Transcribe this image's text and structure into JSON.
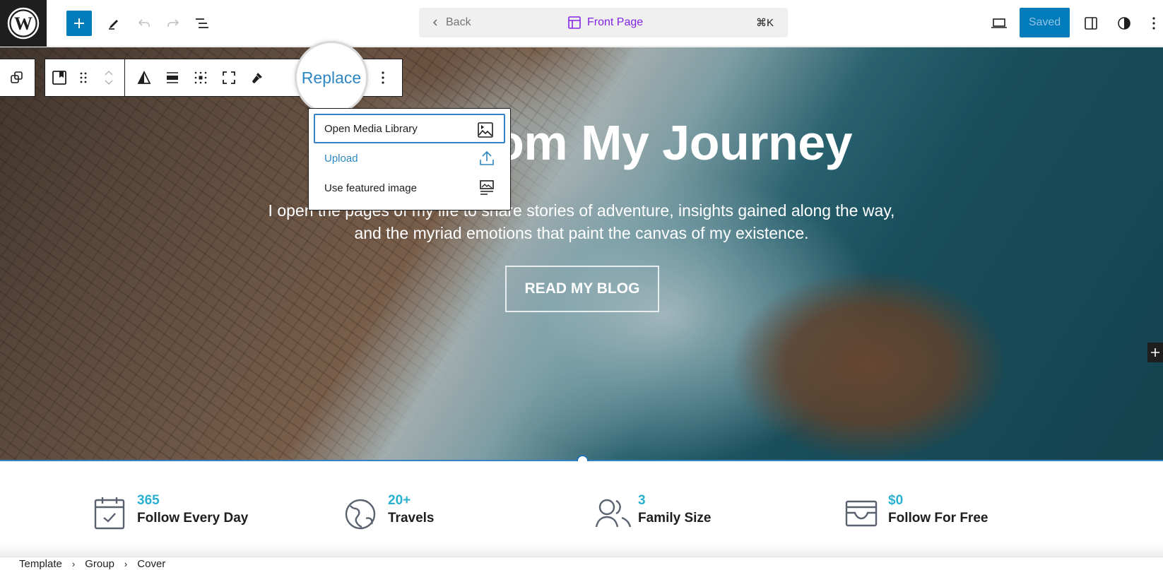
{
  "header": {
    "logo": "wordpress-logo",
    "inserter_icon": "plus-icon",
    "tools_icon": "pencil-icon",
    "undo_icon": "undo-icon",
    "redo_icon": "redo-icon",
    "document_overview_icon": "list-view-icon",
    "command_bar": {
      "back_label": "Back",
      "document_title": "Front Page",
      "shortcut": "⌘K"
    },
    "preview_icon": "desktop-icon",
    "save_label": "Saved",
    "settings_icon": "sidebar-toggle-icon",
    "styles_icon": "contrast-icon",
    "options_icon": "more-vertical-icon"
  },
  "block_toolbar": {
    "items": [
      "select-parent",
      "cover-block",
      "drag-handle",
      "move-up",
      "move-down",
      "duotone",
      "align",
      "content-position",
      "full-height",
      "overlay-color"
    ],
    "replace_label": "Replace",
    "more_icon": "more-vertical-icon"
  },
  "replace_menu": {
    "items": [
      {
        "label": "Open Media Library",
        "icon": "media-icon",
        "focused": true
      },
      {
        "label": "Upload",
        "icon": "upload-icon",
        "accent": "#2e87c2"
      },
      {
        "label": "Use featured image",
        "icon": "featured-image-icon"
      }
    ]
  },
  "cover": {
    "heading": "Tales From My Journey",
    "text": "I open the pages of my life to share stories of adventure, insights gained along the way, and the myriad emotions that paint the canvas of my existence.",
    "button_label": "READ MY BLOG"
  },
  "stats": [
    {
      "icon": "calendar-check-icon",
      "value": "365",
      "label": "Follow Every Day"
    },
    {
      "icon": "globe-icon",
      "value": "20+",
      "label": "Travels"
    },
    {
      "icon": "people-icon",
      "value": "3",
      "label": "Family Size"
    },
    {
      "icon": "wallet-icon",
      "value": "$0",
      "label": "Follow For Free"
    }
  ],
  "breadcrumb": [
    "Template",
    "Group",
    "Cover"
  ],
  "colors": {
    "accent": "#007cba",
    "title_purple": "#8224e3",
    "stat_value": "#2bb0cf",
    "focus": "#3582c4"
  }
}
